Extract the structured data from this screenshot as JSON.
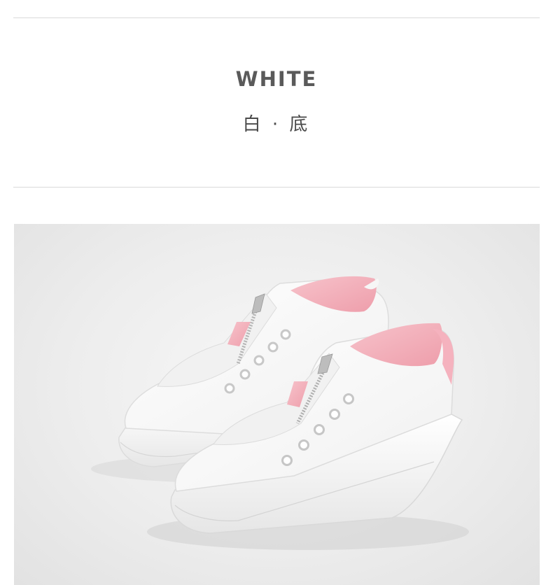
{
  "header": {
    "title": "WHITE",
    "subtitle": "白 · 底"
  },
  "product_photo": {
    "subject": "white-sneakers-pair",
    "colors": {
      "upper": "#ffffff",
      "lining": "#f2a9b4",
      "background": "#ececec",
      "zipper": "#b8b8b8"
    }
  }
}
